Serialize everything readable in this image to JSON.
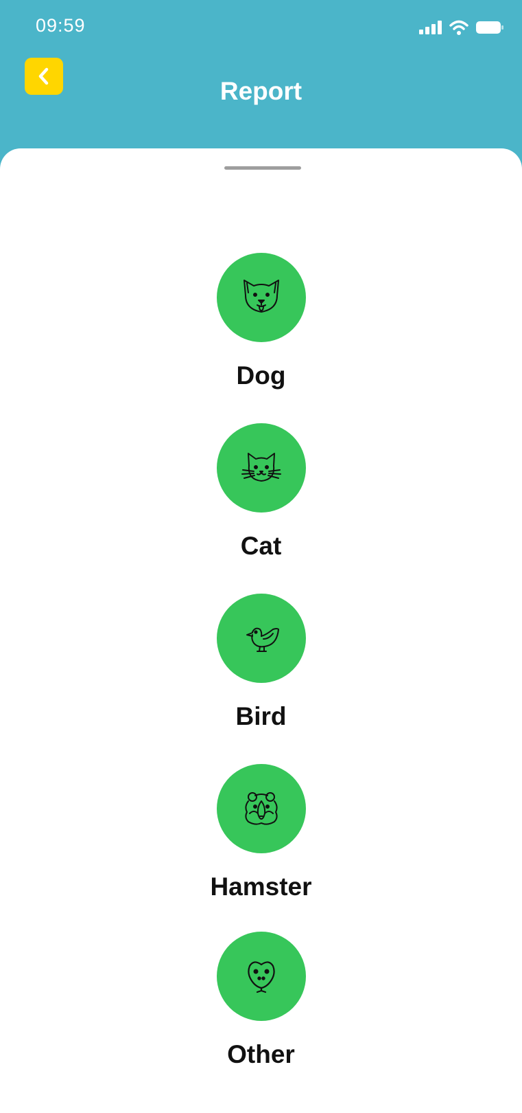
{
  "status_bar": {
    "time": "09:59",
    "icons": [
      "cellular-signal-icon",
      "wifi-icon",
      "battery-icon"
    ]
  },
  "header": {
    "title": "Report",
    "back_icon": "chevron-left-icon"
  },
  "colors": {
    "header_bg": "#4bb5c9",
    "back_button": "#ffd600",
    "option_circle": "#37c65a",
    "sheet_bg": "#ffffff"
  },
  "pets": [
    {
      "label": "Dog",
      "icon": "dog-icon"
    },
    {
      "label": "Cat",
      "icon": "cat-icon"
    },
    {
      "label": "Bird",
      "icon": "bird-icon"
    },
    {
      "label": "Hamster",
      "icon": "hamster-icon"
    },
    {
      "label": "Other",
      "icon": "other-animal-icon"
    }
  ]
}
